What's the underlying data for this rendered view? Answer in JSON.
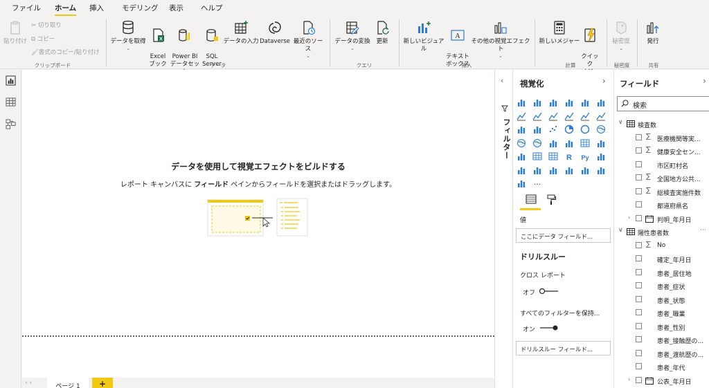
{
  "tabs": [
    "ファイル",
    "ホーム",
    "挿入",
    "モデリング",
    "表示",
    "ヘルプ"
  ],
  "ribbon": {
    "clipboard": {
      "paste": "貼り付け",
      "cut": "切り取り",
      "copy": "コピー",
      "format_painter": "書式のコピー/貼り付け",
      "group": "クリップボード"
    },
    "data": {
      "get_data": "データを取得",
      "excel": "Excel\nブック",
      "powerbi": "Power BI\nデータセット",
      "sql": "SQL\nServer",
      "enter_data": "データの入力",
      "dataverse": "Dataverse",
      "recent": "最近のソース",
      "group": "データ"
    },
    "query": {
      "transform": "データの変換",
      "refresh": "更新",
      "group": "クエリ"
    },
    "insert": {
      "new_visual": "新しいビジュアル",
      "text_box": "テキスト\nボックス",
      "more_visuals": "その他の視覚エフェクト",
      "group": "挿入"
    },
    "calc": {
      "new_measure": "新しいメジャー",
      "quick_measure": "クイック\nメジャー",
      "group": "計算"
    },
    "sensitivity": {
      "label": "秘密度",
      "group": "秘密度"
    },
    "share": {
      "publish": "発行",
      "group": "共有"
    }
  },
  "canvas": {
    "title": "データを使用して視覚エフェクトをビルドする",
    "subtitle_pre": "レポート キャンバスに ",
    "subtitle_bold": "フィールド",
    "subtitle_post": " ペインからフィールドを選択またはドラッグします。"
  },
  "pages": {
    "page1": "ページ 1",
    "add": "+"
  },
  "filters": {
    "label": "フィルター"
  },
  "viz": {
    "title": "視覚化",
    "values_label": "値",
    "values_placeholder": "ここにデータ フィールド...",
    "drillthrough_title": "ドリルスルー",
    "cross_report": "クロス レポート",
    "cross_report_state": "オフ",
    "keep_filters": "すべてのフィルターを保持...",
    "keep_filters_state": "オン",
    "drill_placeholder": "ドリルスルー フィールド..."
  },
  "fields": {
    "title": "フィールド",
    "search_placeholder": "検索",
    "tables": [
      {
        "name": "検査数",
        "items": [
          {
            "label": "医療機関等実...",
            "sigma": true
          },
          {
            "label": "健康安全セン...",
            "sigma": true
          },
          {
            "label": "市区町村名",
            "sigma": false
          },
          {
            "label": "全国地方公共...",
            "sigma": true
          },
          {
            "label": "総検査実施件数",
            "sigma": true
          },
          {
            "label": "都道府県名",
            "sigma": false
          }
        ],
        "date": "判明_年月日"
      },
      {
        "name": "陽性患者数",
        "items": [
          {
            "label": "No",
            "sigma": true
          },
          {
            "label": "確定_年月日",
            "sigma": false
          },
          {
            "label": "患者_居住地",
            "sigma": false
          },
          {
            "label": "患者_症状",
            "sigma": false
          },
          {
            "label": "患者_状態",
            "sigma": false
          },
          {
            "label": "患者_職業",
            "sigma": false
          },
          {
            "label": "患者_性別",
            "sigma": false
          },
          {
            "label": "患者_接触歴の...",
            "sigma": false
          },
          {
            "label": "患者_渡航歴の...",
            "sigma": false
          },
          {
            "label": "患者_年代",
            "sigma": false
          }
        ],
        "date": "公表_年月日"
      }
    ]
  },
  "colors": {
    "accent": "#f2c811",
    "excel": "#1d6f42",
    "blue": "#2b7cd3",
    "selected": "#252423"
  }
}
